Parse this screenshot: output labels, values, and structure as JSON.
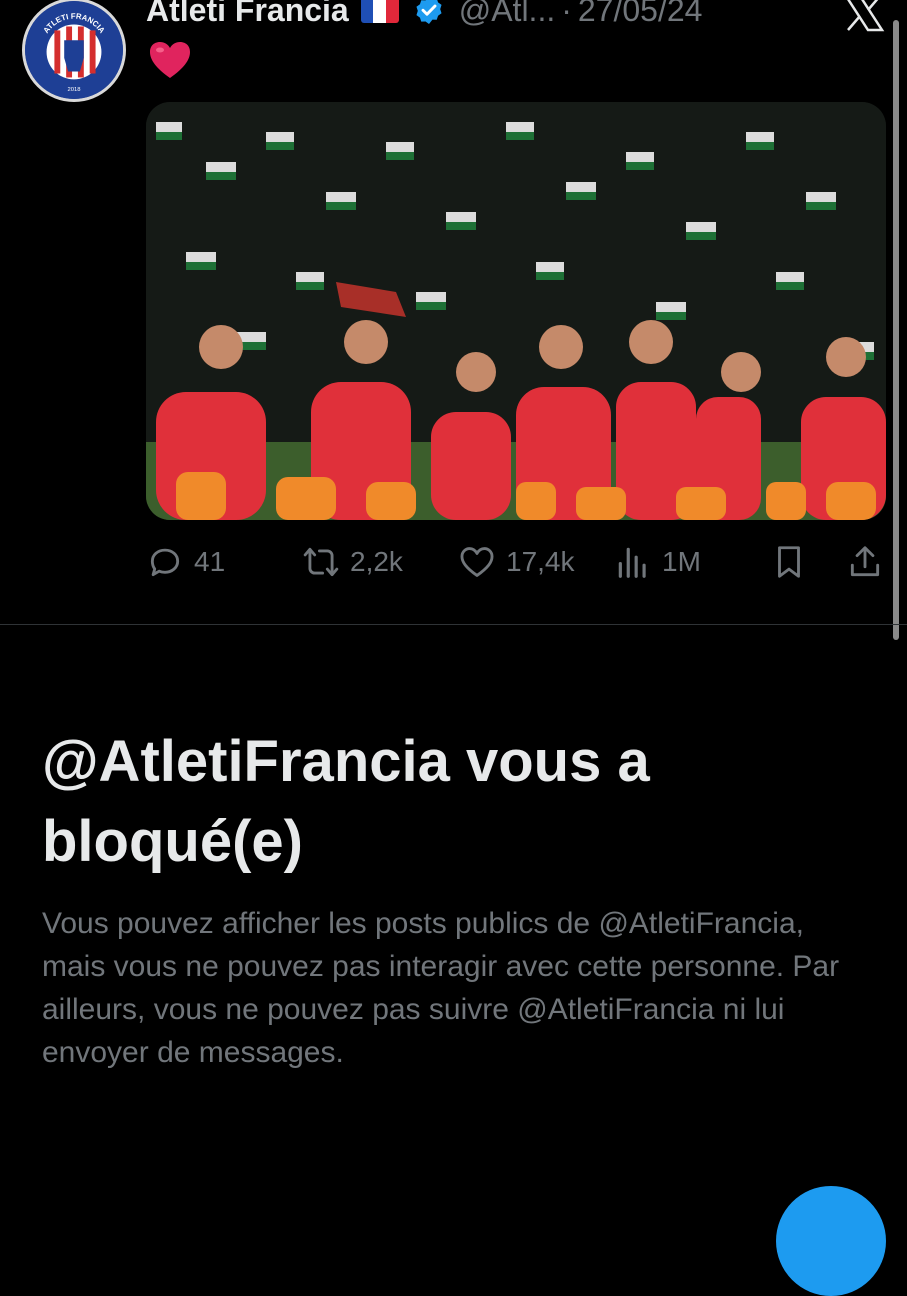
{
  "tweet": {
    "display_name": "Atleti Francia",
    "handle": "@Atl...",
    "separator": "·",
    "date": "27/05/24",
    "emoji_text": "❤️",
    "avatar_text": {
      "top": "ATLETI FRANCIA",
      "year": "2018"
    },
    "stats": {
      "replies": "41",
      "reposts": "2,2k",
      "likes": "17,4k",
      "views": "1M"
    }
  },
  "blocked": {
    "title": "@AtletiFrancia vous a bloqué(e)",
    "description": "Vous pouvez afficher les posts publics de @AtletiFrancia, mais vous ne pouvez pas interagir avec cette personne. Par ailleurs, vous ne pouvez pas suivre @AtletiFrancia ni lui envoyer de messages."
  },
  "colors": {
    "background": "#000000",
    "primary_text": "#e7e9ea",
    "secondary_text": "#71767b",
    "accent": "#1d9bf0",
    "heart": "#e0245e"
  },
  "icons": [
    "close-icon",
    "verified-badge-icon",
    "reply-icon",
    "repost-icon",
    "like-icon",
    "views-icon",
    "bookmark-icon",
    "share-icon"
  ]
}
